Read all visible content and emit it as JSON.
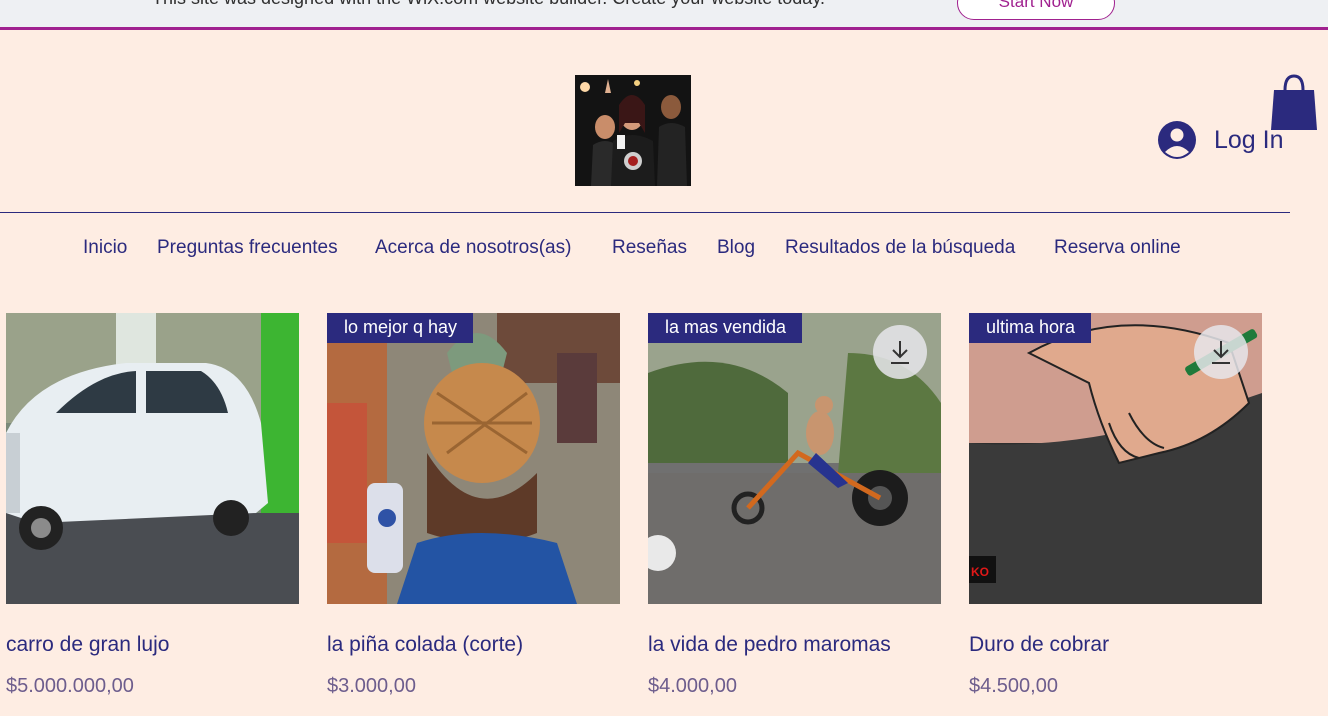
{
  "banner": {
    "message": "This site was designed with the WiX.com website builder. Create your website today.",
    "cta": "Start Now"
  },
  "header": {
    "login_label": "Log In"
  },
  "nav": {
    "items": [
      "Inicio",
      "Preguntas frecuentes",
      "Acerca de nosotros(as)",
      "Reseñas",
      "Blog",
      "Resultados de la búsqueda",
      "Reserva online"
    ]
  },
  "products": [
    {
      "name": "carro de gran lujo",
      "price": "$5.000.000,00",
      "ribbon": "",
      "has_download": false
    },
    {
      "name": "la piña colada (corte)",
      "price": "$3.000,00",
      "ribbon": "lo mejor q hay",
      "has_download": false
    },
    {
      "name": "la vida de pedro maromas",
      "price": "$4.000,00",
      "ribbon": "la mas vendida",
      "has_download": true
    },
    {
      "name": "Duro de cobrar",
      "price": "$4.500,00",
      "ribbon": "ultima hora",
      "has_download": true
    }
  ],
  "colors": {
    "background": "#feede3",
    "accent": "#2b2a7e",
    "banner_border": "#a0218f"
  },
  "icons": [
    "user-avatar-icon",
    "shopping-bag-icon",
    "download-icon"
  ]
}
